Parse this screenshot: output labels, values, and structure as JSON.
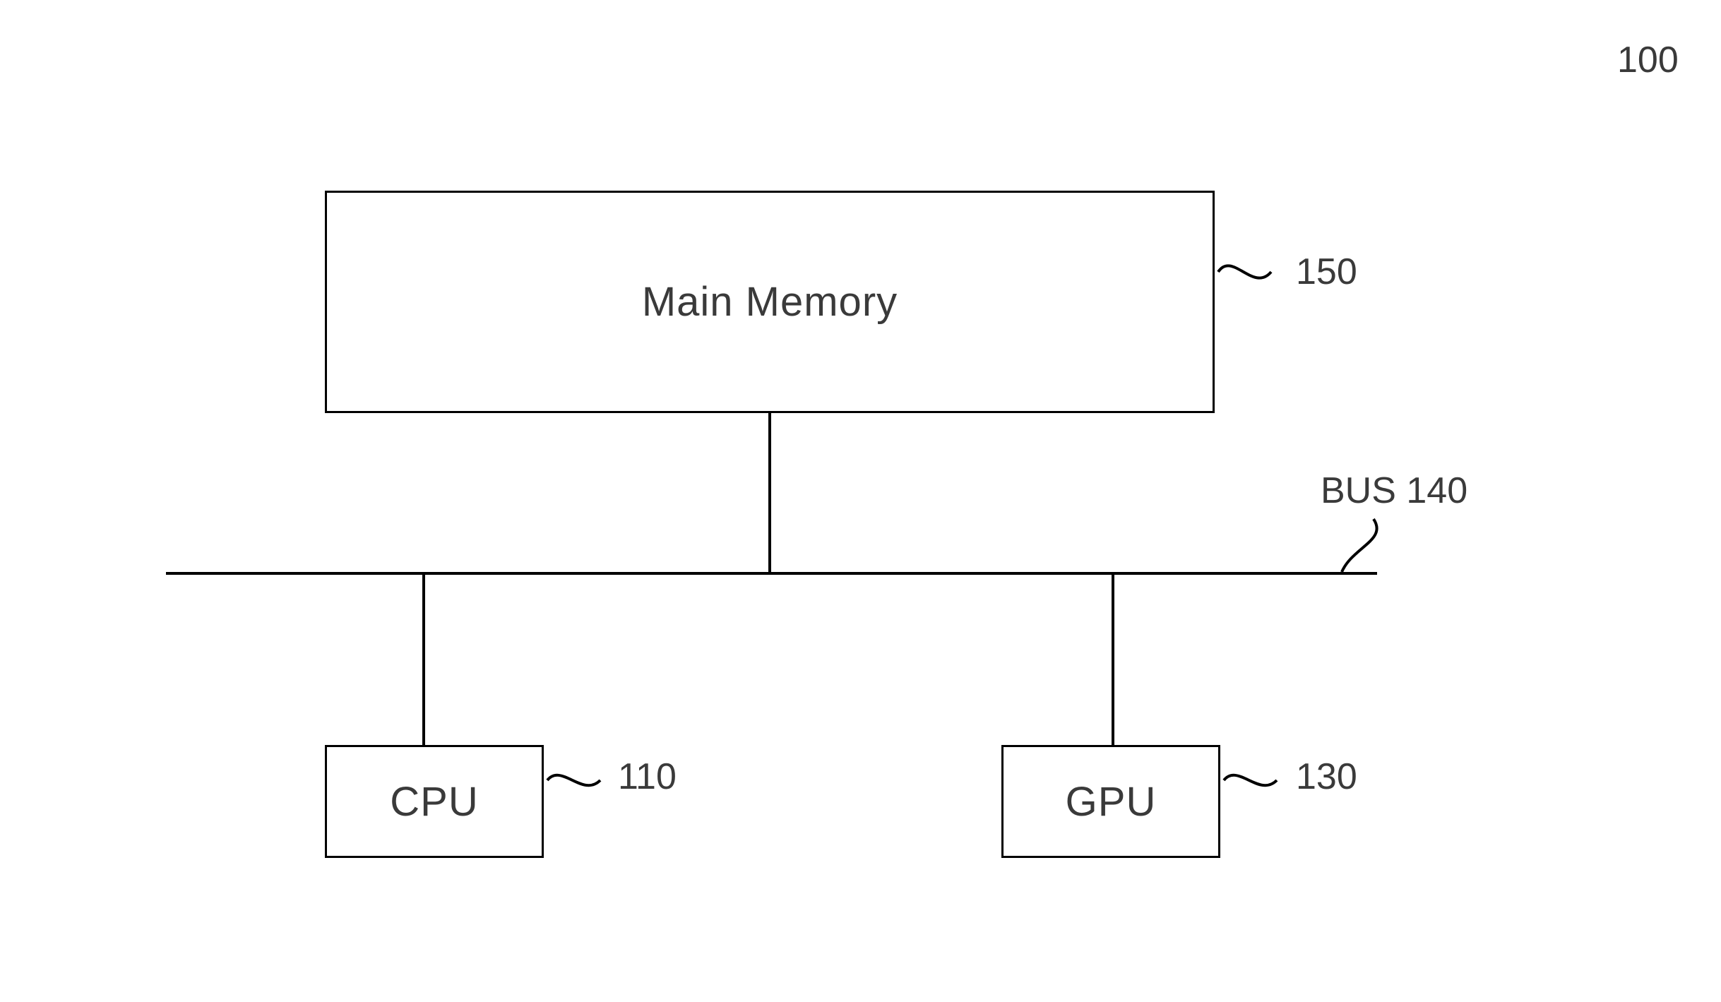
{
  "figure_ref": "100",
  "blocks": {
    "main_memory": {
      "label": "Main Memory",
      "ref": "150"
    },
    "cpu": {
      "label": "CPU",
      "ref": "110"
    },
    "gpu": {
      "label": "GPU",
      "ref": "130"
    }
  },
  "bus": {
    "label": "BUS 140"
  }
}
